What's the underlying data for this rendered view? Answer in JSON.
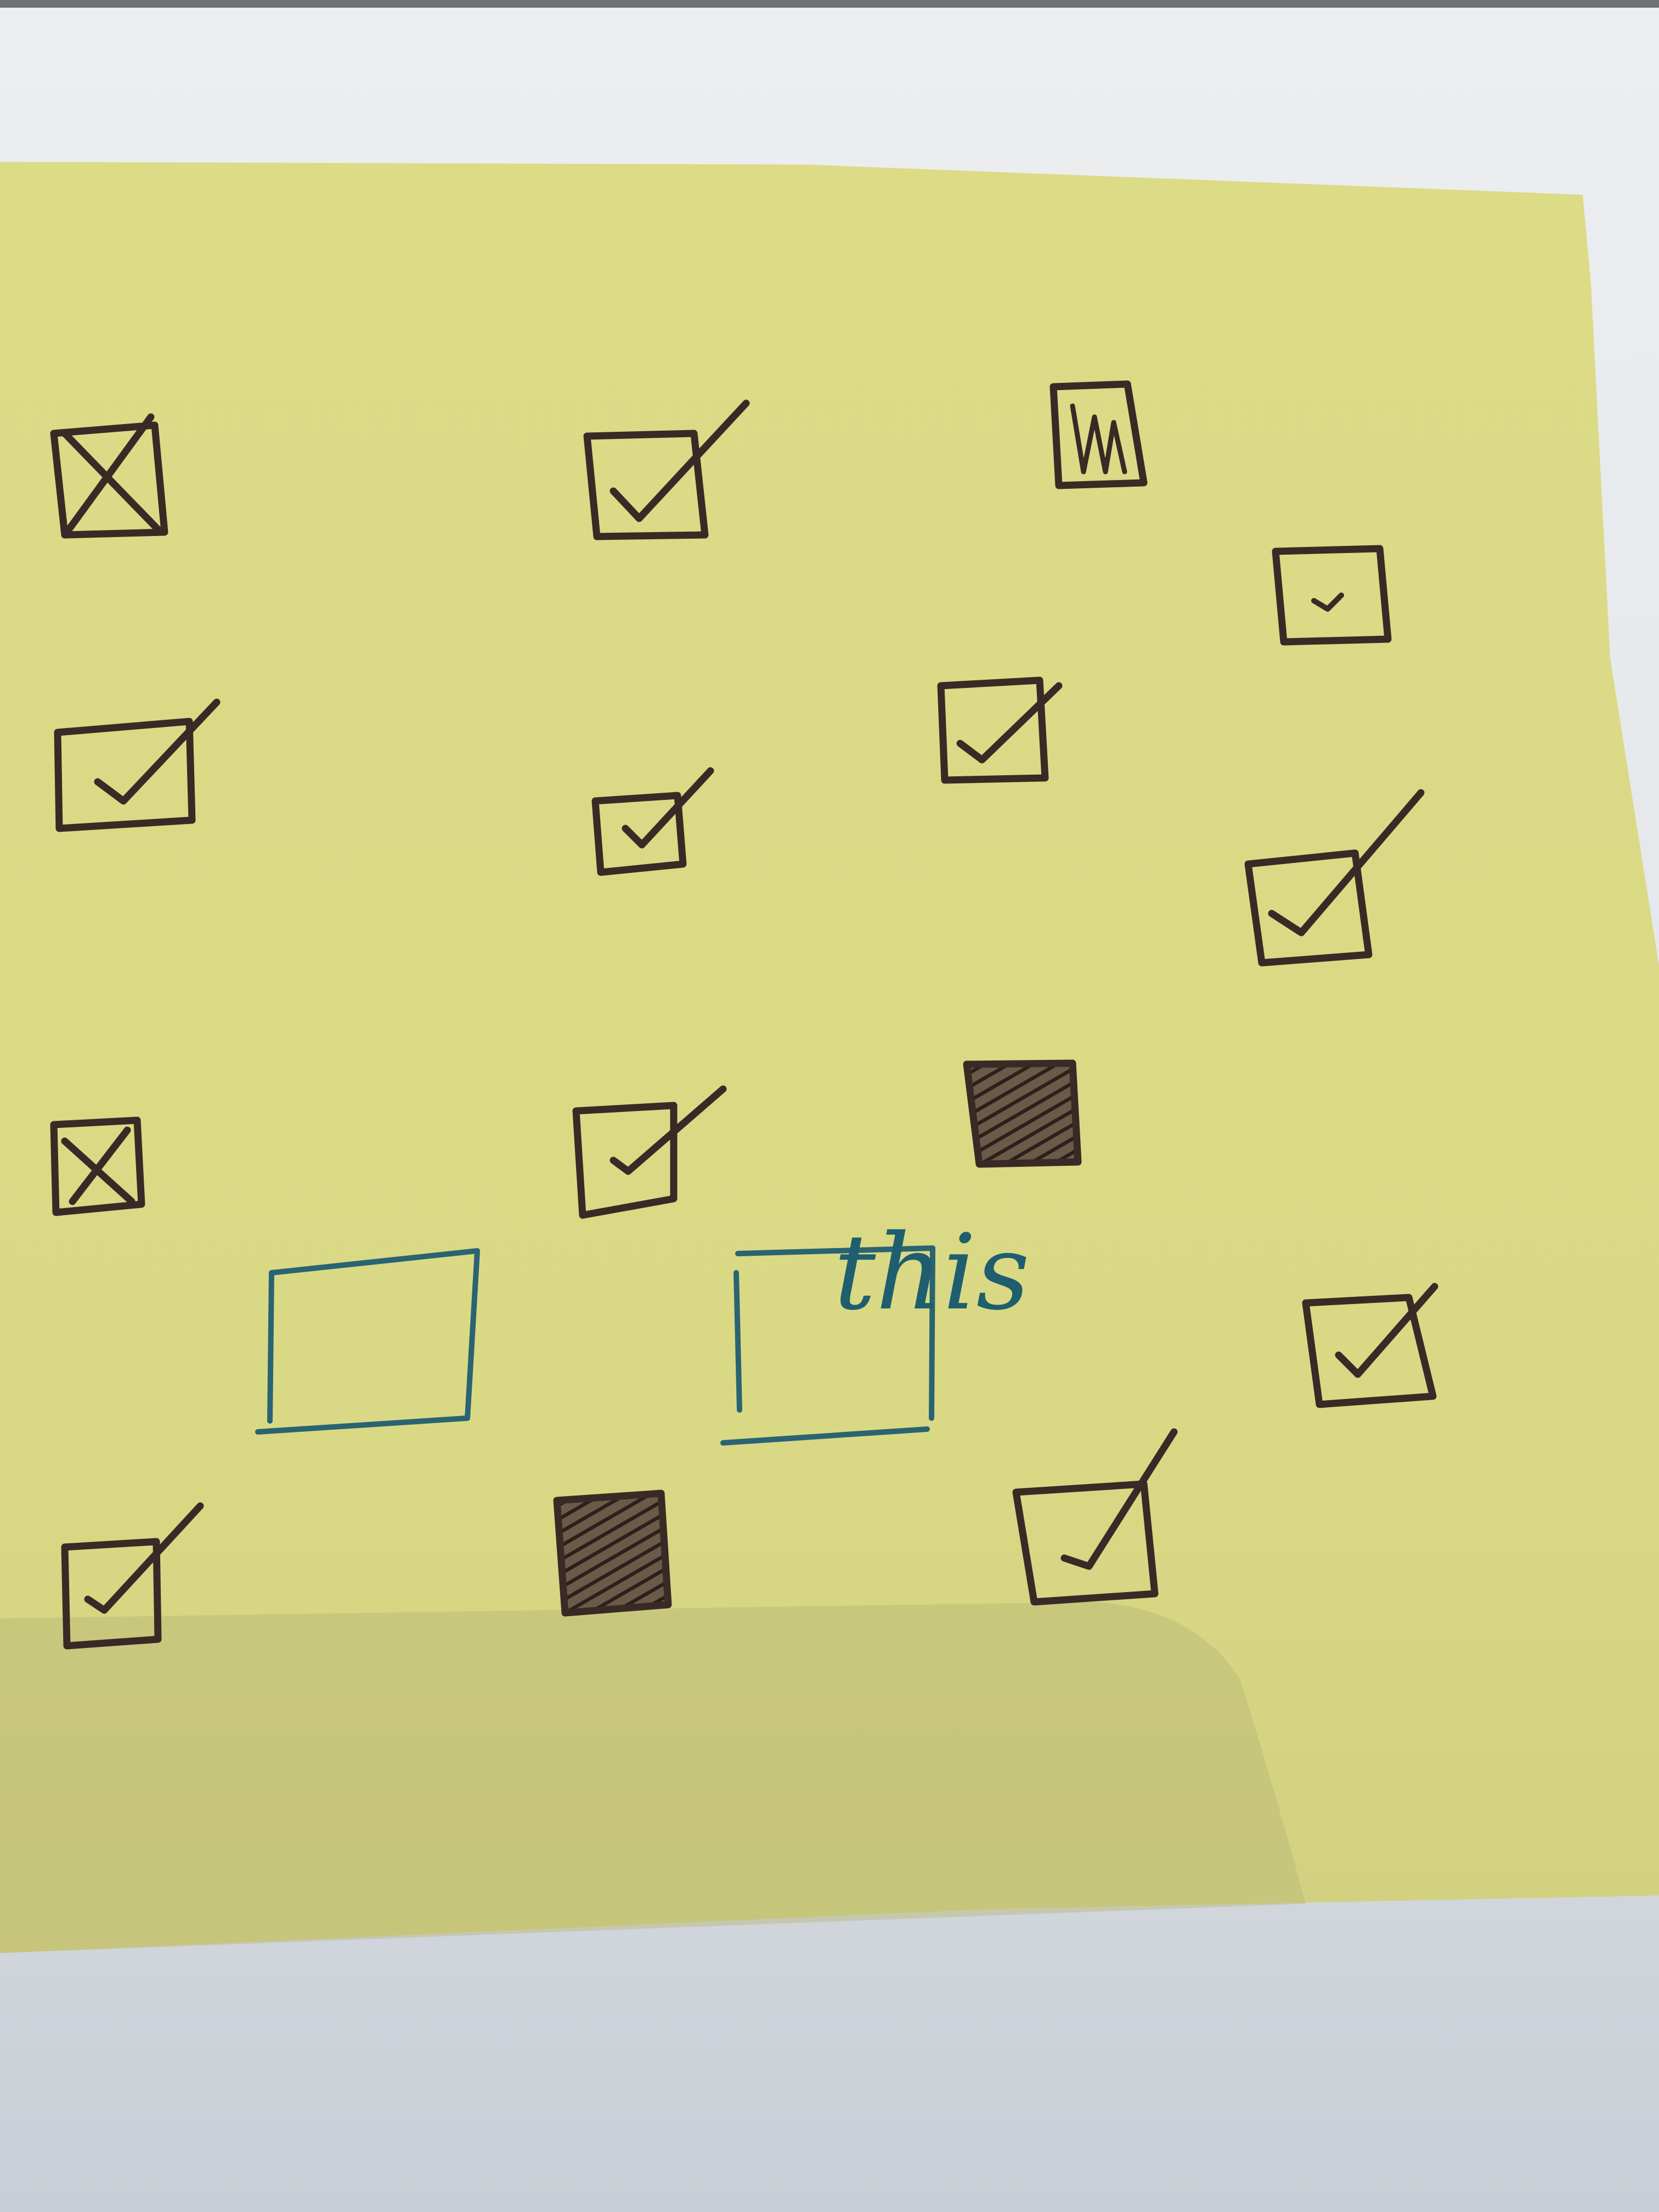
{
  "note": {
    "annotation": "this",
    "paper_color": "#dedd8a",
    "ink_brown": "#3a2a26",
    "ink_blue": "#2a6472"
  },
  "marks": [
    {
      "kind": "cross",
      "state": "checked"
    },
    {
      "kind": "tick",
      "state": "checked"
    },
    {
      "kind": "scribble",
      "state": "filled"
    },
    {
      "kind": "small-tick",
      "state": "checked"
    },
    {
      "kind": "tick",
      "state": "checked"
    },
    {
      "kind": "tick",
      "state": "checked"
    },
    {
      "kind": "tick",
      "state": "checked"
    },
    {
      "kind": "tick",
      "state": "checked"
    },
    {
      "kind": "cross",
      "state": "checked"
    },
    {
      "kind": "tick",
      "state": "checked"
    },
    {
      "kind": "hatched",
      "state": "filled"
    },
    {
      "kind": "empty",
      "state": "unchecked"
    },
    {
      "kind": "empty",
      "state": "unchecked"
    },
    {
      "kind": "tick",
      "state": "checked"
    },
    {
      "kind": "tick",
      "state": "checked"
    },
    {
      "kind": "hatched",
      "state": "filled"
    },
    {
      "kind": "tick",
      "state": "checked"
    }
  ]
}
